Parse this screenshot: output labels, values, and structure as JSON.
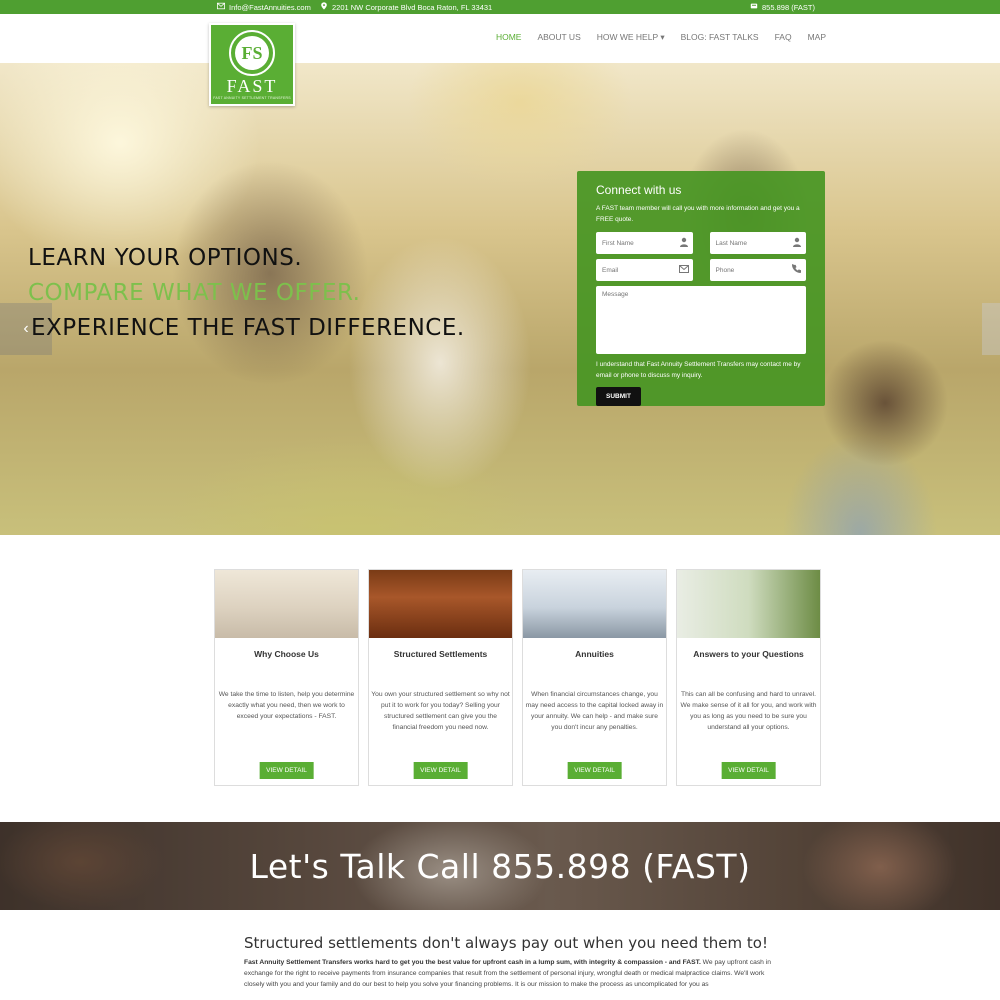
{
  "topbar": {
    "email": "Info@FastAnnuities.com",
    "address": "2201 NW Corporate Blvd Boca Raton, FL 33431",
    "phone": "855.898 (FAST)"
  },
  "logo": {
    "monogram": "FS",
    "word": "FAST",
    "tagline": "FAST ANNUITY SETTLEMENT TRANSFERS"
  },
  "nav": {
    "items": [
      {
        "label": "HOME"
      },
      {
        "label": "ABOUT US"
      },
      {
        "label": "HOW WE HELP ▾"
      },
      {
        "label": "BLOG: FAST TALKS"
      },
      {
        "label": "FAQ"
      },
      {
        "label": "MAP"
      }
    ]
  },
  "hero": {
    "line1": "LEARN YOUR OPTIONS.",
    "line2": "COMPARE WHAT WE OFFER.",
    "line3": "EXPERIENCE THE FAST DIFFERENCE."
  },
  "connect": {
    "title": "Connect with us",
    "intro": "A FAST team member will call you with more information and get you a FREE quote.",
    "first_name_placeholder": "First Name",
    "last_name_placeholder": "Last Name",
    "email_placeholder": "Email",
    "phone_placeholder": "Phone",
    "message_placeholder": "Message",
    "consent": "I understand that Fast Annuity Settlement Transfers may contact me by email or phone to discuss my inquiry.",
    "submit_label": "SUBMIT"
  },
  "cards": [
    {
      "title": "Why Choose Us",
      "text": "We take the time to listen, help you determine exactly what you need, then we work to exceed your expectations - FAST.",
      "button": "VIEW DETAIL"
    },
    {
      "title": "Structured Settlements",
      "text": "You own your structured settlement so why not put it to work for you today? Selling your structured settlement can give you the financial freedom you need now.",
      "button": "VIEW DETAIL"
    },
    {
      "title": "Annuities",
      "text": "When financial circumstances change, you may need access to the capital locked away in your annuity. We can help - and make sure you don't incur any penalties.",
      "button": "VIEW DETAIL"
    },
    {
      "title": "Answers to your Questions",
      "text": "This can all be confusing and hard to unravel. We make sense of it all for you, and work with you as long as you need to be sure you understand all your options.",
      "button": "VIEW DETAIL"
    }
  ],
  "talk": {
    "text": "Let's Talk  Call 855.898 (FAST)"
  },
  "bottom": {
    "heading": "Structured settlements don't always pay out when you need them to!",
    "lead": "Fast Annuity Settlement Transfers works hard to get you the best value for upfront cash in a lump sum, with integrity & compassion - and FAST.",
    "body": " We pay upfront cash in exchange for the right to receive payments from insurance companies that result from the settlement of personal injury, wrongful death or medical malpractice claims. We'll work closely with you and your family and do our best to help you solve your financing problems. It is our mission to make the process as uncomplicated for you as"
  },
  "colors": {
    "brand_green": "#5aae34",
    "topbar_green": "#4f9f31",
    "hero_accent_green": "#7dc04c"
  }
}
